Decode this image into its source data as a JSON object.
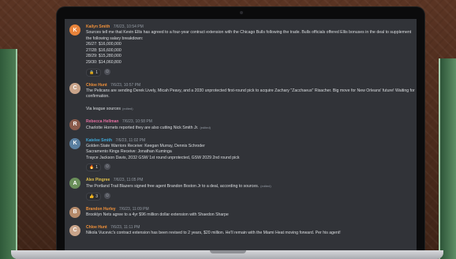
{
  "channel": {
    "messages": [
      {
        "author": "Kailyn Smith",
        "timestamp": "7/6/23, 10:54 PM",
        "name_color": "#f0913a",
        "avatar_color": "#e8833a",
        "lines": [
          "Sources tell me that Kevin Ellis has agreed to a four-year contract extension with the Chicago Bulls following the trade. Bulls officials offered Ellis bonuses in the deal to supplement",
          "the following salary breakdown:",
          "26/27: $16,000,000",
          "27/28: $16,600,000",
          "28/29: $15,280,000",
          "29/30: $14,060,800"
        ],
        "reactions": [
          {
            "emoji": "🔒",
            "count": "1"
          }
        ]
      },
      {
        "author": "Chloe Hunt",
        "timestamp": "7/6/23, 10:57 PM",
        "name_color": "#f0913a",
        "avatar_color": "#c9a48a",
        "lines": [
          "The Pelicans are sending Derek Lively, Micah Peavy, and a 2030 unprotected first-round pick to acquire Zachary \"Zacchaeus\" Risacher. Big move for New Orleans' future! Waiting for",
          "confirmation.",
          "",
          "Via league sources"
        ],
        "edited": "(edited)"
      },
      {
        "author": "Rebecca Hellman",
        "timestamp": "7/6/23, 10:58 PM",
        "name_color": "#e36ea0",
        "avatar_color": "#8a5a4a",
        "lines": [
          "Charlotte Hornets reported they are also cutting Nick Smith Jr."
        ],
        "edited": "(edited)"
      },
      {
        "author": "Katelee Smith",
        "timestamp": "7/6/23, 11:02 PM",
        "name_color": "#3fa9d9",
        "avatar_color": "#5a7fa0",
        "lines": [
          "Golden State Warriors Receive: Keegan Murray, Dennis Schroder",
          "Sacramento Kings Receive: Jonathan Kuminga",
          "Trayce Jackson Davis, 2032 GSW 1st round unprotected, GSW 2029 2nd round pick"
        ],
        "reactions": [
          {
            "emoji": "🔥",
            "count": "1"
          }
        ]
      },
      {
        "author": "Alex Pingree",
        "timestamp": "7/6/23, 11:05 PM",
        "name_color": "#e2c14a",
        "avatar_color": "#6a8f5a",
        "lines": [
          "The Portland Trail Blazers signed free agent Brandon Boston Jr to a deal, according to sources."
        ],
        "edited": "(edited)",
        "reactions": [
          {
            "emoji": "👍",
            "count": "3"
          }
        ]
      },
      {
        "author": "Brandon Hurley",
        "timestamp": "7/6/23, 11:09 PM",
        "name_color": "#f0913a",
        "avatar_color": "#b58a6a",
        "lines": [
          "Brooklyn Nets agree to a 4yr $96 million dollar extension with Shaedon Sharpe"
        ]
      },
      {
        "author": "Chloe Hunt",
        "timestamp": "7/6/23, 11:11 PM",
        "name_color": "#f0913a",
        "avatar_color": "#c9a48a",
        "lines": [
          "Nikola Vucevic's contract extension has been revised to 2 years, $20 million. He'll remain with the Miami Heat moving forward. Per his agent!"
        ]
      }
    ]
  }
}
